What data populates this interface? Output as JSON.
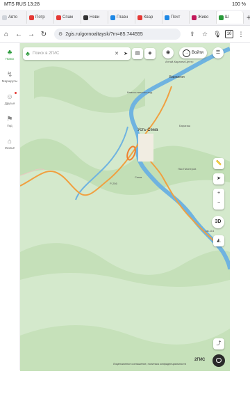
{
  "status": {
    "left": "MTS RUS 13:28",
    "right": "100 %"
  },
  "tabs": [
    {
      "label": "Авто",
      "color": "#cfd3da"
    },
    {
      "label": "Потр",
      "color": "#e53935"
    },
    {
      "label": "Спам",
      "color": "#e53935"
    },
    {
      "label": "Нови",
      "color": "#333333"
    },
    {
      "label": "Главн",
      "color": "#1e88e5"
    },
    {
      "label": "Квар",
      "color": "#e53935"
    },
    {
      "label": "Почт",
      "color": "#1e88e5"
    },
    {
      "label": "Живо",
      "color": "#c2185b"
    },
    {
      "label": "Ш",
      "color": "#2a9a3a"
    }
  ],
  "tab_add": "+",
  "url": "2gis.ru/gornoaltaysk/?m=85.744555",
  "tab_count": "10",
  "sidebar": [
    {
      "label": "Поиск",
      "icon": "tree-icon"
    },
    {
      "label": "Маршруты",
      "icon": "route-icon"
    },
    {
      "label": "Друзья",
      "icon": "friends-icon"
    },
    {
      "label": "Гид",
      "icon": "flag-icon"
    },
    {
      "label": "Жильё",
      "icon": "building-icon"
    }
  ],
  "search": {
    "placeholder": "Поиск в 2ГИС"
  },
  "login_label": "Войти",
  "map_labels": {
    "altai": "Алтай-Карагем Центр",
    "baranchul": "Барангол",
    "kamyshla": "Камышлинская вод.",
    "ustsema": "Усть-Сема",
    "pikpionerov": "Пик Пионеров",
    "road_p256": "P-256",
    "road_km": "км-114",
    "sema": "Сема",
    "lebed": "Барагаш",
    "katun": "Катунь"
  },
  "controls": {
    "layers3d": "3D",
    "zoom_in": "+",
    "zoom_out": "−"
  },
  "footer": {
    "logo": "2ГИС",
    "legal": "Лицензионное соглашение, политика конфиденциальности"
  },
  "colors": {
    "accent": "#2a9a3a",
    "road": "#f0a040",
    "river": "#6fb3e0",
    "map": "#cfe6c8"
  }
}
